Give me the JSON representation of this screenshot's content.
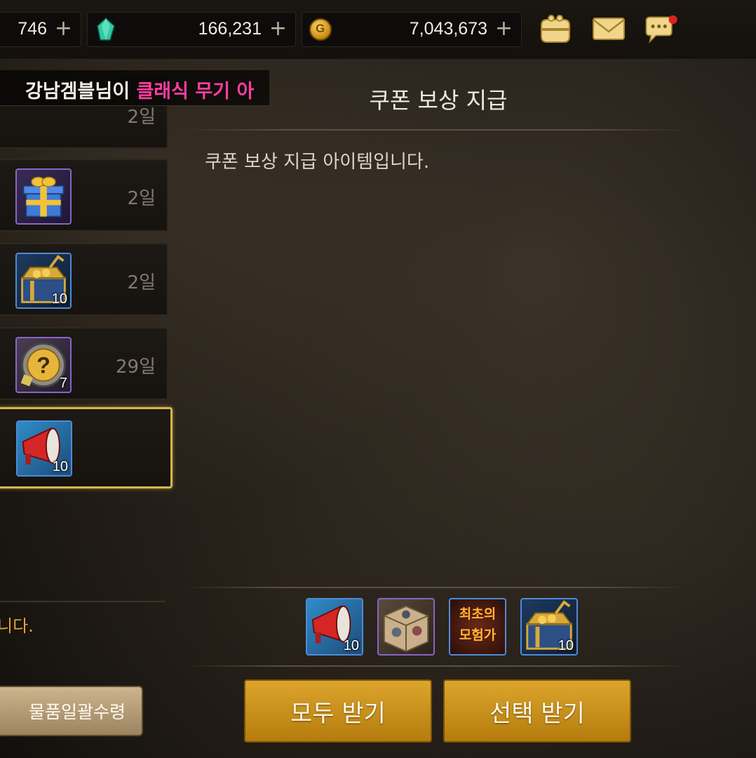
{
  "currency": {
    "stamina": {
      "value": "746",
      "plus": "+"
    },
    "gems": {
      "value": "166,231",
      "plus": "+"
    },
    "gold": {
      "value": "7,043,673",
      "plus": "+"
    }
  },
  "notice": {
    "white": "강남겜블님이 ",
    "pink": "클래식 무기 아"
  },
  "list": [
    {
      "days": "2일",
      "qty": ""
    },
    {
      "days": "2일",
      "qty": ""
    },
    {
      "days": "2일",
      "qty": "10"
    },
    {
      "days": "29일",
      "qty": "7"
    },
    {
      "days": "",
      "qty": "10"
    }
  ],
  "detail": {
    "title": "쿠폰 보상 지급",
    "description": "쿠폰 보상 지급 아이템입니다."
  },
  "rewards": [
    {
      "qty": "10"
    },
    {
      "qty": ""
    },
    {
      "qty": "",
      "label": "최초의 모험가"
    },
    {
      "qty": "10"
    }
  ],
  "left_footer": "니다.",
  "buttons": {
    "bulk_receive": "물품일괄수령",
    "receive_all": "모두 받기",
    "receive_selected": "선택 받기"
  },
  "icons": [
    "gem-icon",
    "coin-icon",
    "purse-icon",
    "mail-icon",
    "chat-icon",
    "gift-box-icon",
    "treasure-chest-icon",
    "mystery-box-icon",
    "megaphone-icon",
    "item-crate-icon",
    "title-scroll-icon"
  ],
  "colors": {
    "accent_gold": "#dca52c",
    "notice_pink": "#ff3da0",
    "selected_border": "#d8b548"
  }
}
